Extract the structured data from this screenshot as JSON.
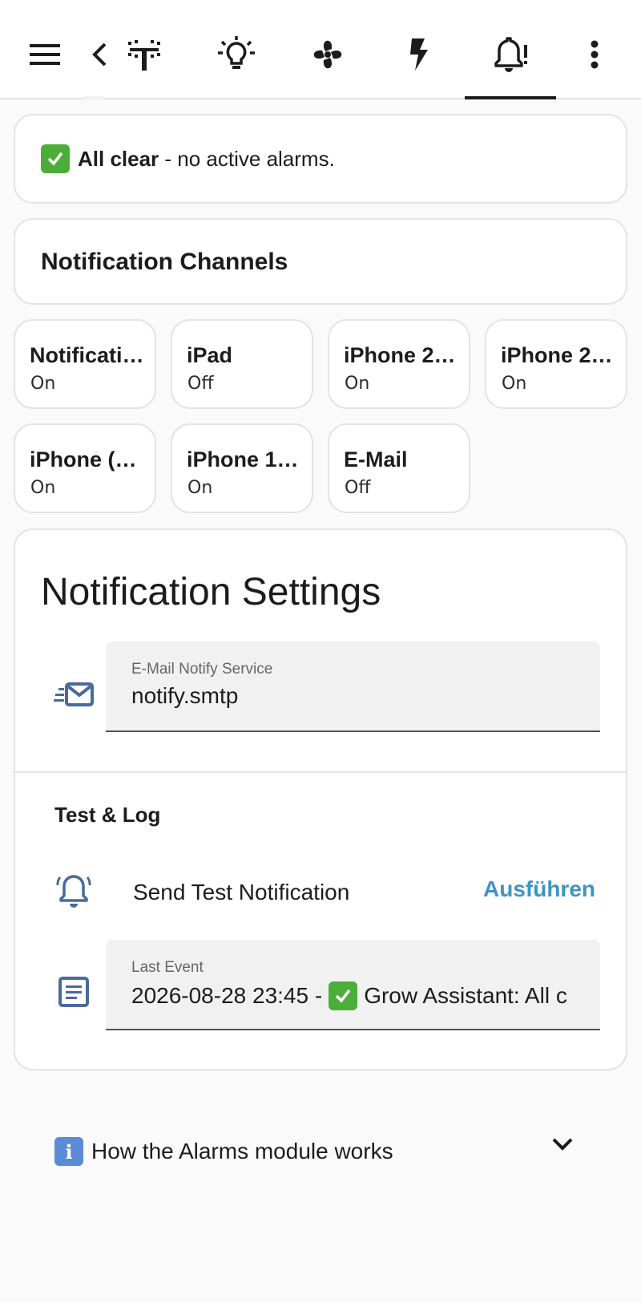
{
  "topbar": {
    "tabs": [
      {
        "icon": "irrigation-icon"
      },
      {
        "icon": "lightbulb-icon"
      },
      {
        "icon": "fan-icon"
      },
      {
        "icon": "lightning-icon"
      },
      {
        "icon": "bell-alert-icon",
        "active": true
      }
    ]
  },
  "alarm_status": {
    "bold": "All clear",
    "rest": " - no active alarms."
  },
  "channels": {
    "title": "Notification Channels",
    "items": [
      {
        "name": "Notifications",
        "state": "On"
      },
      {
        "name": "iPad",
        "state": "Off"
      },
      {
        "name": "iPhone 2…",
        "state": "On"
      },
      {
        "name": "iPhone 2…",
        "state": "On"
      },
      {
        "name": "iPhone (…",
        "state": "On"
      },
      {
        "name": "iPhone 1…",
        "state": "On"
      },
      {
        "name": "E-Mail",
        "state": "Off"
      }
    ]
  },
  "settings": {
    "title": "Notification Settings",
    "email_field": {
      "label": "E-Mail Notify Service",
      "value": "notify.smtp"
    },
    "test_log": {
      "title": "Test & Log",
      "send_label": "Send Test Notification",
      "run_label": "Ausführen",
      "last_event_label": "Last Event",
      "last_event_prefix": "2026-08-28 23:45 -",
      "last_event_rest": "Grow Assistant: All c"
    }
  },
  "help": {
    "label": "How the Alarms module works"
  },
  "colors": {
    "accent": "#3b95c6",
    "icon_blue": "#4a6a9c",
    "check_green": "#4cae3a"
  }
}
